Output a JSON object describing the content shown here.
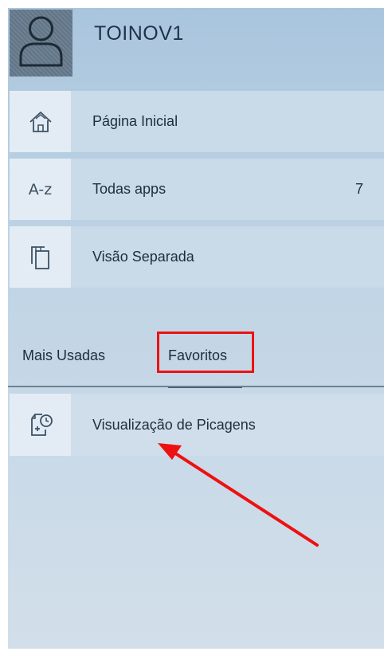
{
  "user": {
    "name": "TOINOV1"
  },
  "nav": {
    "items": [
      {
        "label": "Página Inicial",
        "icon": "home-icon"
      },
      {
        "label": "Todas apps",
        "icon": "a-z-icon",
        "icon_text": "A-z",
        "count": "7"
      },
      {
        "label": "Visão Separada",
        "icon": "split-view-icon"
      }
    ]
  },
  "tabs": [
    {
      "label": "Mais Usadas"
    },
    {
      "label": "Favoritos",
      "selected": true
    }
  ],
  "favorites": [
    {
      "label": "Visualização de Picagens",
      "icon": "timesheet-clock-icon"
    }
  ],
  "colors": {
    "highlight": "#ee1111",
    "panel_top": "#a9c5dd",
    "panel_bottom": "#d2dfea",
    "text": "#1d2d3c"
  }
}
